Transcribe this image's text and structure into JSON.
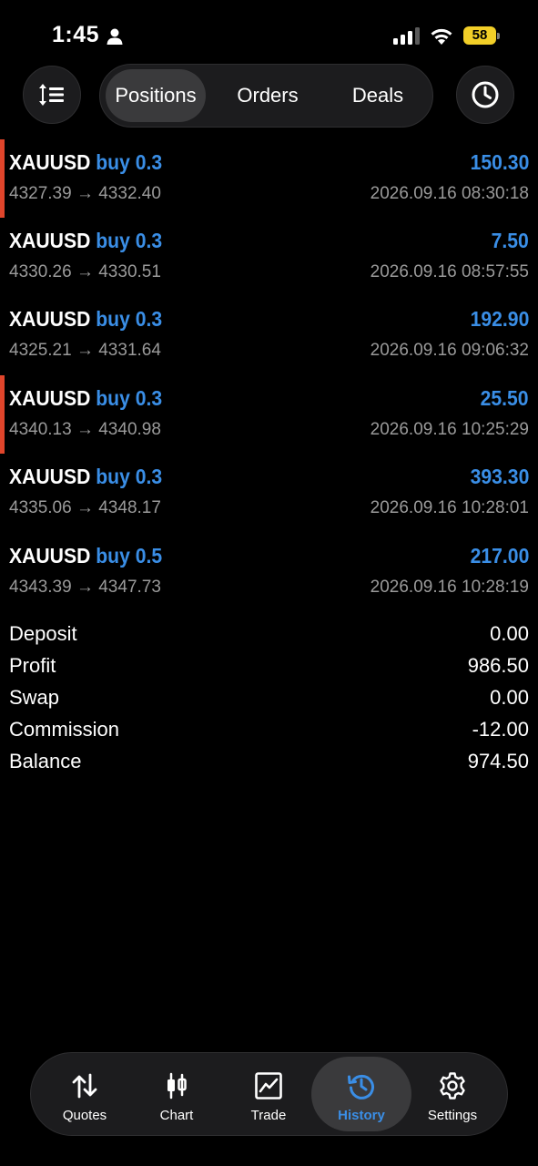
{
  "status_bar": {
    "time": "1:45",
    "battery": "58"
  },
  "top": {
    "segments": [
      {
        "label": "Positions",
        "active": true
      },
      {
        "label": "Orders",
        "active": false
      },
      {
        "label": "Deals",
        "active": false
      }
    ],
    "icons": {
      "left": "sort-icon",
      "right": "clock-icon"
    }
  },
  "deals": [
    {
      "symbol": "XAUUSD",
      "side": "buy 0.3",
      "profit": "150.30",
      "prices": "4327.39 → 4332.40",
      "datetime": "2026.09.16 08:30:18",
      "marked": true
    },
    {
      "symbol": "XAUUSD",
      "side": "buy 0.3",
      "profit": "7.50",
      "prices": "4330.26 → 4330.51",
      "datetime": "2026.09.16 08:57:55",
      "marked": false
    },
    {
      "symbol": "XAUUSD",
      "side": "buy 0.3",
      "profit": "192.90",
      "prices": "4325.21 → 4331.64",
      "datetime": "2026.09.16 09:06:32",
      "marked": false
    },
    {
      "symbol": "XAUUSD",
      "side": "buy 0.3",
      "profit": "25.50",
      "prices": "4340.13 → 4340.98",
      "datetime": "2026.09.16 10:25:29",
      "marked": true
    },
    {
      "symbol": "XAUUSD",
      "side": "buy 0.3",
      "profit": "393.30",
      "prices": "4335.06 → 4348.17",
      "datetime": "2026.09.16 10:28:01",
      "marked": false
    },
    {
      "symbol": "XAUUSD",
      "side": "buy 0.5",
      "profit": "217.00",
      "prices": "4343.39 → 4347.73",
      "datetime": "2026.09.16 10:28:19",
      "marked": false
    }
  ],
  "summary": [
    {
      "label": "Deposit",
      "value": "0.00"
    },
    {
      "label": "Profit",
      "value": "986.50"
    },
    {
      "label": "Swap",
      "value": "0.00"
    },
    {
      "label": "Commission",
      "value": "-12.00"
    },
    {
      "label": "Balance",
      "value": "974.50"
    }
  ],
  "tabbar": [
    {
      "label": "Quotes",
      "icon": "quotes-icon",
      "active": false
    },
    {
      "label": "Chart",
      "icon": "chart-icon",
      "active": false
    },
    {
      "label": "Trade",
      "icon": "trade-icon",
      "active": false
    },
    {
      "label": "History",
      "icon": "history-icon",
      "active": true
    },
    {
      "label": "Settings",
      "icon": "settings-icon",
      "active": false
    }
  ],
  "colors": {
    "accent": "#3a8ee6",
    "marker": "#e0452b",
    "muted": "#9a9a9a",
    "battery": "#f2cf28"
  }
}
